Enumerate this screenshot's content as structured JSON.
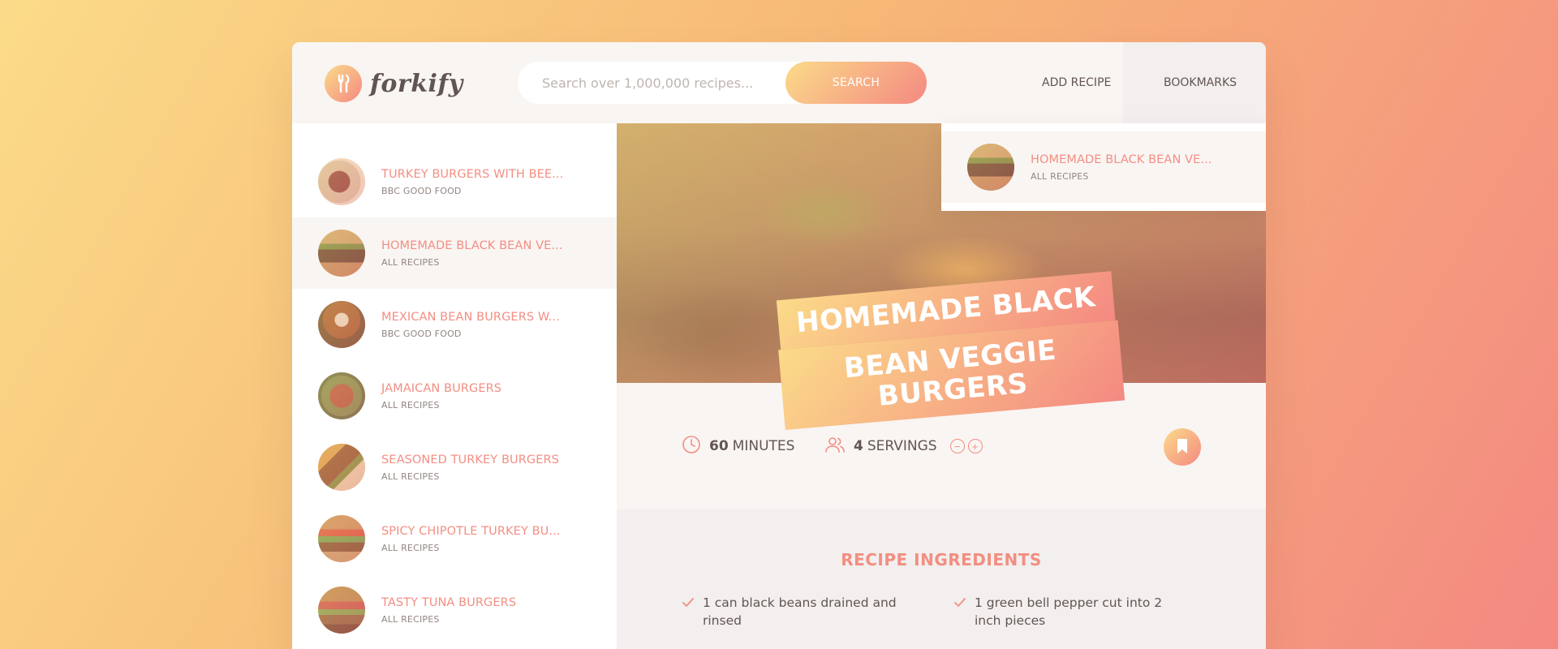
{
  "header": {
    "logo_text": "forkify",
    "search_placeholder": "Search over 1,000,000 recipes...",
    "search_button": "SEARCH",
    "nav": {
      "add_recipe": "ADD RECIPE",
      "bookmarks": "BOOKMARKS"
    }
  },
  "bookmarks_dropdown": {
    "items": [
      {
        "title": "HOMEMADE BLACK BEAN VE...",
        "publisher": "ALL RECIPES"
      }
    ]
  },
  "results": [
    {
      "title": "TURKEY BURGERS WITH BEE...",
      "publisher": "BBC GOOD FOOD",
      "active": false
    },
    {
      "title": "HOMEMADE BLACK BEAN VE...",
      "publisher": "ALL RECIPES",
      "active": true
    },
    {
      "title": "MEXICAN BEAN BURGERS W...",
      "publisher": "BBC GOOD FOOD",
      "active": false
    },
    {
      "title": "JAMAICAN BURGERS",
      "publisher": "ALL RECIPES",
      "active": false
    },
    {
      "title": "SEASONED TURKEY BURGERS",
      "publisher": "ALL RECIPES",
      "active": false
    },
    {
      "title": "SPICY CHIPOTLE TURKEY BU...",
      "publisher": "ALL RECIPES",
      "active": false
    },
    {
      "title": "TASTY TUNA BURGERS",
      "publisher": "ALL RECIPES",
      "active": false
    }
  ],
  "recipe": {
    "title_line1": "HOMEMADE BLACK",
    "title_line2": "BEAN VEGGIE BURGERS",
    "cooking_time": "60",
    "cooking_time_unit": "MINUTES",
    "servings": "4",
    "servings_unit": "SERVINGS",
    "servings_decrease": "−",
    "servings_increase": "+",
    "ingredients_heading": "RECIPE INGREDIENTS",
    "ingredients": [
      "1 can black beans drained and rinsed",
      "1 green bell pepper cut into 2 inch pieces"
    ]
  },
  "colors": {
    "accent": "#f38e82",
    "gradient_start": "#fbdb89",
    "gradient_end": "#f48982",
    "panel": "#f9f5f3"
  }
}
